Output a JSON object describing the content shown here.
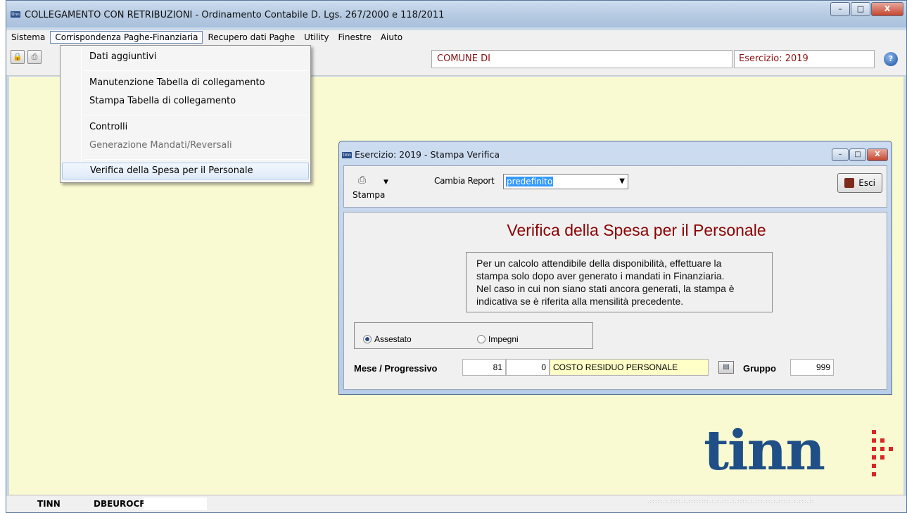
{
  "window": {
    "title": "COLLEGAMENTO CON RETRIBUZIONI - Ordinamento Contabile D. Lgs. 267/2000 e 118/2011",
    "icon_text": "tinn",
    "caption_buttons": [
      "–",
      "□",
      "X"
    ]
  },
  "menubar": [
    "Sistema",
    "Corrispondenza Paghe-Finanziaria",
    "Recupero dati Paghe",
    "Utility",
    "Finestre",
    "Aiuto"
  ],
  "toolbar": {
    "comune_label": "COMUNE DI",
    "esercizio_label": "Esercizio: 2019",
    "help_glyph": "?"
  },
  "dropdown": {
    "items": [
      {
        "label": "Dati aggiuntivi"
      },
      {
        "label": "Manutenzione Tabella di collegamento"
      },
      {
        "label": "Stampa Tabella di collegamento"
      },
      {
        "label": "Controlli"
      },
      {
        "label": "Generazione Mandati/Reversali"
      },
      {
        "label": "Verifica della Spesa per il Personale"
      }
    ]
  },
  "dialog": {
    "title": "Esercizio: 2019 - Stampa Verifica",
    "caption_buttons": [
      "–",
      "□",
      "X"
    ],
    "stampa_label": "Stampa",
    "cambia_report_label": "Cambia Report",
    "report_value": "predefinito",
    "esci_label": "Esci",
    "heading": "Verifica della Spesa per il Personale",
    "note_lines": [
      "Per un calcolo attendibile della disponibilità, effettuare la",
      "stampa solo dopo aver generato i mandati in Finanziaria.",
      "Nel caso in cui non siano stati ancora generati, la stampa è",
      "indicativa se è riferita alla mensilità precedente."
    ],
    "radio_assestato": "Assestato",
    "radio_impegni": "Impegni",
    "selected_radio": "Assestato",
    "mese_label": "Mese / Progressivo",
    "mese_value": "81",
    "progressivo_value": "0",
    "descrizione_value": "COSTO RESIDUO PERSONALE",
    "gruppo_label": "Gruppo",
    "gruppo_value": "999"
  },
  "statusbar": {
    "user": "TINN",
    "db": "DBEUROCF_"
  },
  "logo": {
    "text": "tinn",
    "colors": {
      "text": "#1f4f86",
      "dots": "#d92626"
    }
  }
}
